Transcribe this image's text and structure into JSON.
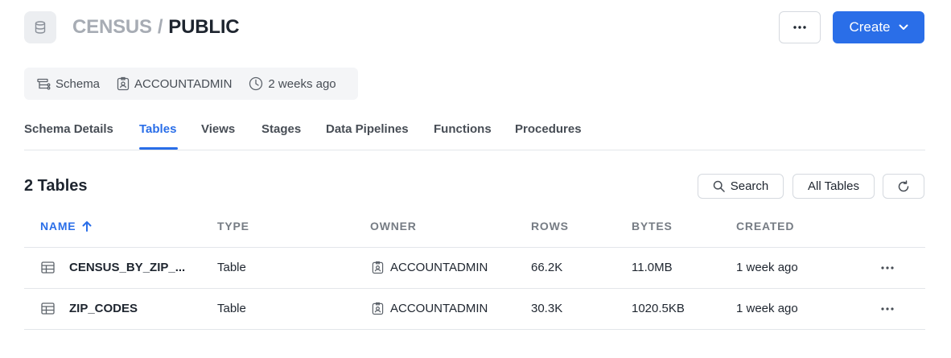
{
  "header": {
    "database": "CENSUS",
    "separator": "/",
    "schema": "PUBLIC",
    "icon": "database-icon",
    "more_icon": "more-horizontal-icon",
    "create_label": "Create"
  },
  "meta": {
    "type_label": "Schema",
    "owner": "ACCOUNTADMIN",
    "age": "2 weeks ago"
  },
  "tabs": [
    {
      "label": "Schema Details",
      "active": false
    },
    {
      "label": "Tables",
      "active": true
    },
    {
      "label": "Views",
      "active": false
    },
    {
      "label": "Stages",
      "active": false
    },
    {
      "label": "Data Pipelines",
      "active": false
    },
    {
      "label": "Functions",
      "active": false
    },
    {
      "label": "Procedures",
      "active": false
    }
  ],
  "toolbar": {
    "count_title": "2 Tables",
    "search_label": "Search",
    "filter_label": "All Tables",
    "refresh_icon": "refresh-icon"
  },
  "table": {
    "columns": [
      "NAME",
      "TYPE",
      "OWNER",
      "ROWS",
      "BYTES",
      "CREATED"
    ],
    "sort_column": "NAME",
    "sort_direction": "ascending",
    "rows": [
      {
        "name": "CENSUS_BY_ZIP_...",
        "type": "Table",
        "owner": "ACCOUNTADMIN",
        "rows": "66.2K",
        "bytes": "11.0MB",
        "created": "1 week ago"
      },
      {
        "name": "ZIP_CODES",
        "type": "Table",
        "owner": "ACCOUNTADMIN",
        "rows": "30.3K",
        "bytes": "1020.5KB",
        "created": "1 week ago"
      }
    ]
  },
  "colors": {
    "accent": "#2a6ee8",
    "text": "#1e252f",
    "muted": "#767c84",
    "border": "#e3e6ea"
  }
}
